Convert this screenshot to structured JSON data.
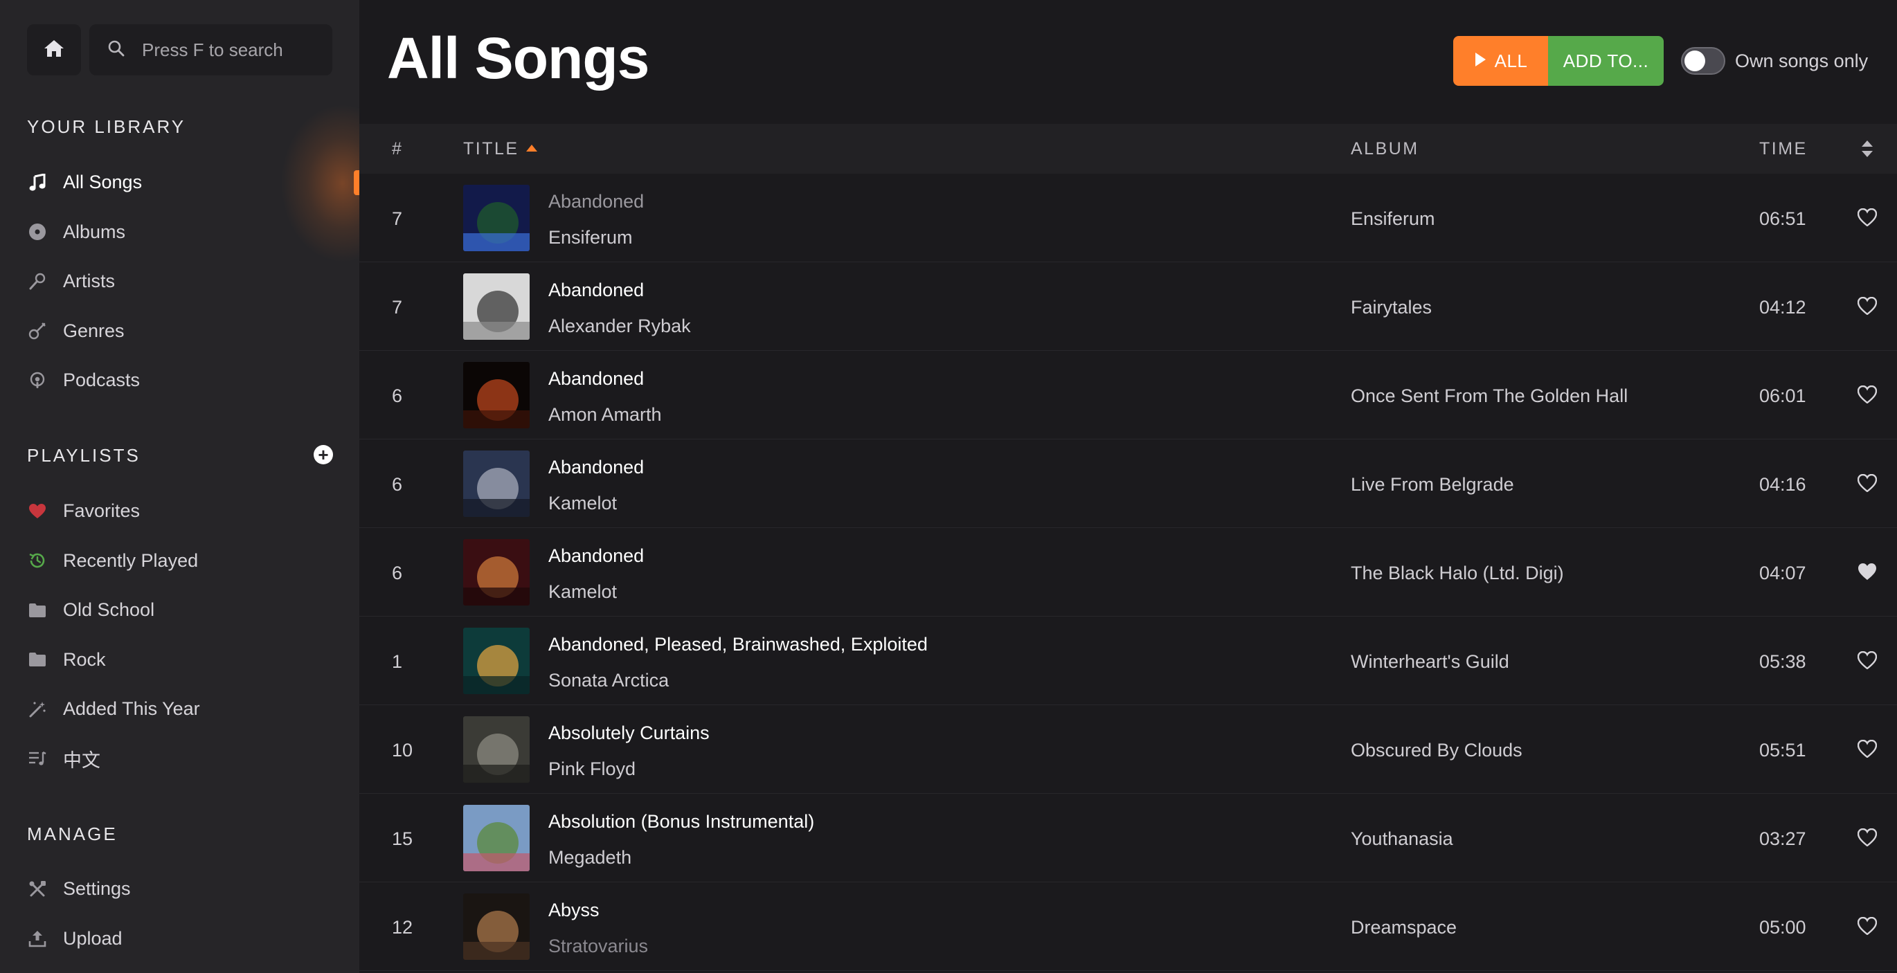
{
  "search": {
    "placeholder": "Press F to search"
  },
  "sidebar": {
    "library_title": "YOUR LIBRARY",
    "library": [
      {
        "label": "All Songs",
        "icon": "music-note-icon",
        "active": true
      },
      {
        "label": "Albums",
        "icon": "disc-icon"
      },
      {
        "label": "Artists",
        "icon": "microphone-icon"
      },
      {
        "label": "Genres",
        "icon": "guitar-icon"
      },
      {
        "label": "Podcasts",
        "icon": "podcast-icon"
      }
    ],
    "playlists_title": "PLAYLISTS",
    "playlists": [
      {
        "label": "Favorites",
        "icon": "heart-icon",
        "color": "#c8363d"
      },
      {
        "label": "Recently Played",
        "icon": "history-icon",
        "color": "#56a94a"
      },
      {
        "label": "Old School",
        "icon": "folder-icon"
      },
      {
        "label": "Rock",
        "icon": "folder-icon"
      },
      {
        "label": "Added This Year",
        "icon": "magic-wand-icon"
      },
      {
        "label": "中文",
        "icon": "playlist-icon"
      }
    ],
    "manage_title": "MANAGE",
    "manage": [
      {
        "label": "Settings",
        "icon": "tools-icon"
      },
      {
        "label": "Upload",
        "icon": "upload-icon"
      }
    ]
  },
  "main": {
    "title": "All Songs",
    "play_all_label": "ALL",
    "add_to_label": "ADD TO...",
    "own_songs_label": "Own songs only",
    "own_songs_enabled": false
  },
  "table": {
    "headers": {
      "num": "#",
      "title": "TITLE",
      "album": "ALBUM",
      "time": "TIME"
    },
    "sort_column": "TITLE",
    "sort_direction": "ascending",
    "rows": [
      {
        "num": "7",
        "title": "Abandoned",
        "artist": "Ensiferum",
        "album": "Ensiferum",
        "time": "06:51",
        "liked": false,
        "cover": [
          "#121a4a",
          "#1f5a2c",
          "#3a6fd8"
        ]
      },
      {
        "num": "7",
        "title": "Abandoned",
        "artist": "Alexander Rybak",
        "album": "Fairytales",
        "time": "04:12",
        "liked": false,
        "cover": [
          "#d8d8d8",
          "#3a3a3a",
          "#8c8c8c"
        ]
      },
      {
        "num": "6",
        "title": "Abandoned",
        "artist": "Amon Amarth",
        "album": "Once Sent From The Golden Hall",
        "time": "06:01",
        "liked": false,
        "cover": [
          "#0b0605",
          "#b8441c",
          "#3d1408"
        ]
      },
      {
        "num": "6",
        "title": "Abandoned",
        "artist": "Kamelot",
        "album": "Live From Belgrade",
        "time": "04:16",
        "liked": false,
        "cover": [
          "#2a3550",
          "#a6a9b8",
          "#141824"
        ]
      },
      {
        "num": "6",
        "title": "Abandoned",
        "artist": "Kamelot",
        "album": "The Black Halo (Ltd. Digi)",
        "time": "04:07",
        "liked": true,
        "cover": [
          "#3a0e12",
          "#c9773a",
          "#1c0708"
        ]
      },
      {
        "num": "1",
        "title": "Abandoned, Pleased, Brainwashed, Exploited",
        "artist": "Sonata Arctica",
        "album": "Winterheart's Guild",
        "time": "05:38",
        "liked": false,
        "cover": [
          "#0d3b3a",
          "#d9a040",
          "#0a2224"
        ]
      },
      {
        "num": "10",
        "title": "Absolutely Curtains",
        "artist": "Pink Floyd",
        "album": "Obscured By Clouds",
        "time": "05:51",
        "liked": false,
        "cover": [
          "#3b3b36",
          "#8b8a80",
          "#1d1d1a"
        ]
      },
      {
        "num": "15",
        "title": "Absolution (Bonus Instrumental)",
        "artist": "Megadeth",
        "album": "Youthanasia",
        "time": "03:27",
        "liked": false,
        "cover": [
          "#7a9bc4",
          "#5c8a3c",
          "#c25a6c"
        ]
      },
      {
        "num": "12",
        "title": "Abyss",
        "artist": "Stratovarius",
        "album": "Dreamspace",
        "time": "05:00",
        "liked": false,
        "cover": [
          "#1a1512",
          "#a8764a",
          "#4a3222"
        ]
      }
    ]
  },
  "colors": {
    "accent_orange": "#ff7f2a",
    "accent_green": "#56a94a",
    "favorite_red": "#c8363d"
  }
}
